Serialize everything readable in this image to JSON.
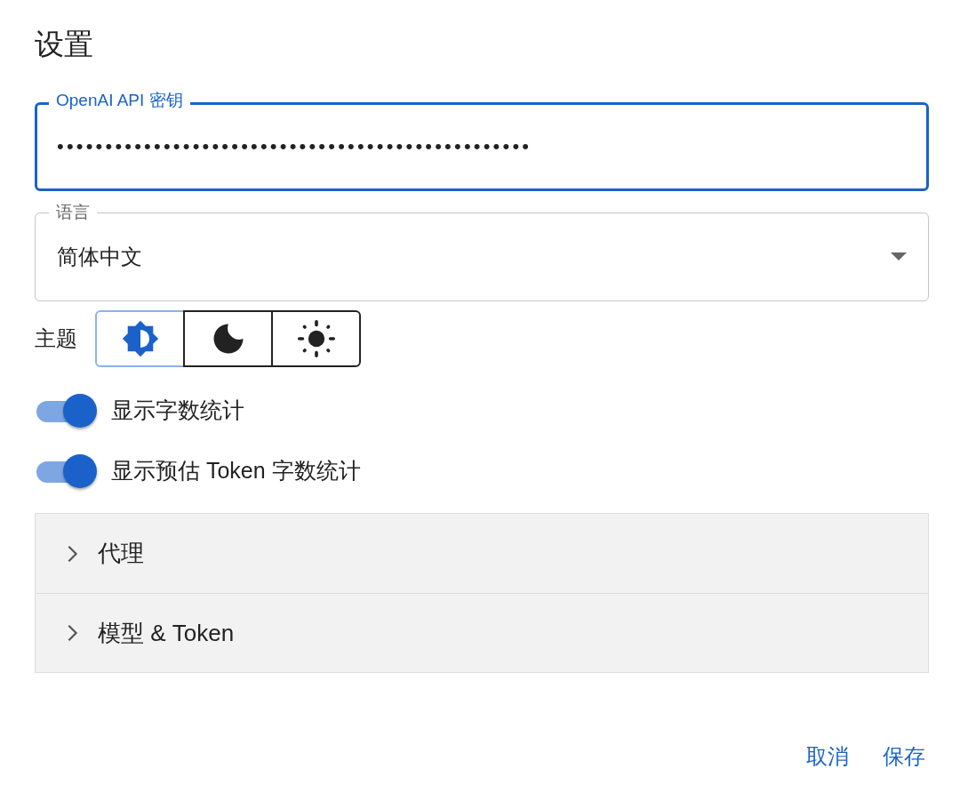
{
  "title": "设置",
  "api_key_field": {
    "label": "OpenAI API 密钥",
    "value": "•••••••••••••••••••••••••••••••••••••••••••••••••",
    "focused": true
  },
  "language_select": {
    "label": "语言",
    "value": "简体中文"
  },
  "theme": {
    "label": "主题",
    "options": [
      {
        "kind": "auto",
        "selected": true
      },
      {
        "kind": "dark",
        "selected": false
      },
      {
        "kind": "light",
        "selected": false
      }
    ]
  },
  "toggles": [
    {
      "label": "显示字数统计",
      "on": true
    },
    {
      "label": "显示预估 Token 字数统计",
      "on": true
    }
  ],
  "sections": [
    {
      "title": "代理",
      "expanded": false
    },
    {
      "title": "模型 & Token",
      "expanded": false
    }
  ],
  "buttons": [
    "取消",
    "保存"
  ]
}
